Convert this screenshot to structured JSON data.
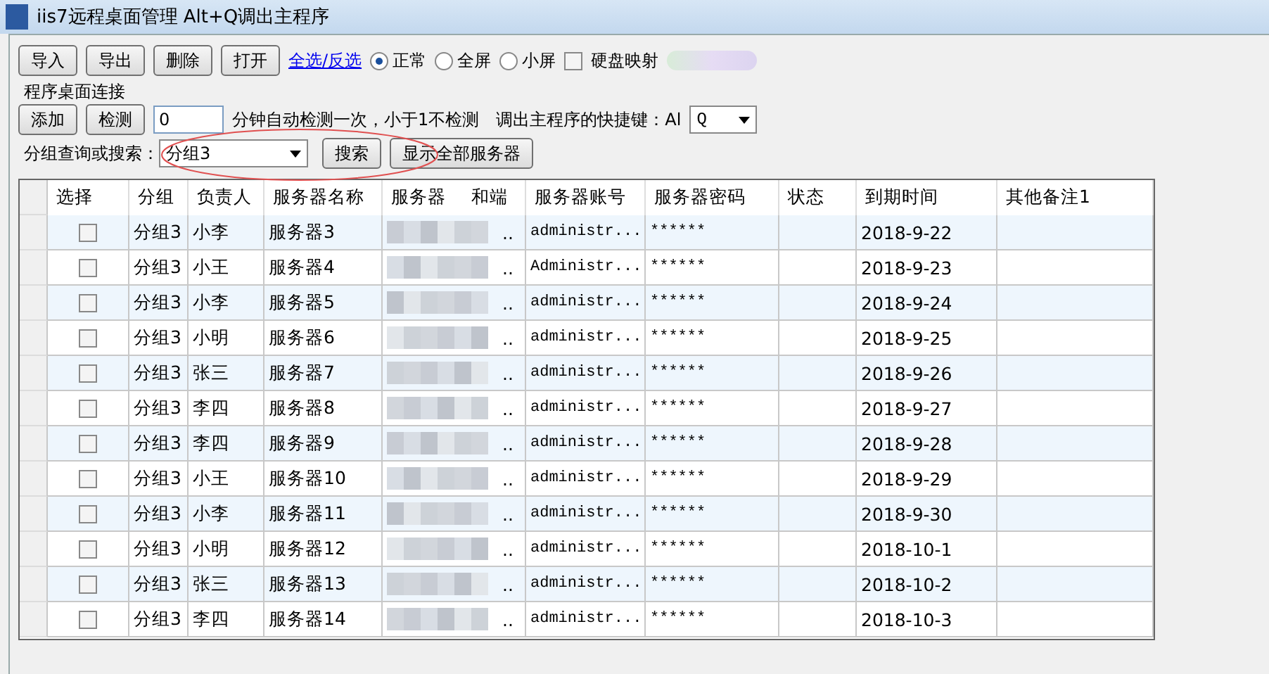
{
  "window": {
    "title": "iis7远程桌面管理 Alt+Q调出主程序"
  },
  "toolbar": {
    "buttons": [
      "导入",
      "导出",
      "删除",
      "打开"
    ],
    "link": "全选/反选",
    "view_modes": [
      {
        "label": "正常",
        "selected": true
      },
      {
        "label": "全屏",
        "selected": false
      },
      {
        "label": "小屏",
        "selected": false
      }
    ],
    "disk_mapping": {
      "label": "硬盘映射",
      "checked": false
    }
  },
  "group": {
    "title": "程序桌面连接",
    "buttons": [
      "添加",
      "检测"
    ],
    "interval": {
      "value": "0"
    },
    "interval_label": "分钟自动检测一次，小于1不检测",
    "hotkey_label": "调出主程序的快捷键：Al",
    "hotkey": {
      "value": "Q"
    },
    "search_label": "分组查询或搜索：",
    "search": {
      "value": "分组3"
    },
    "search_button": "搜索",
    "show_all_button": "显示全部服务器"
  },
  "table": {
    "columns": [
      "选择",
      "分组",
      "负责人",
      "服务器名称",
      {
        "parts": [
          "服务器",
          "和端"
        ]
      },
      "服务器账号",
      "服务器密码",
      "状态",
      "到期时间",
      "其他备注1"
    ],
    "rows": [
      {
        "checked": false,
        "group": "分组3",
        "owner": "小李",
        "name": "服务器3",
        "address": "..",
        "account": "administr...",
        "password": "******",
        "status": "",
        "expires": "2018-9-22"
      },
      {
        "checked": false,
        "group": "分组3",
        "owner": "小王",
        "name": "服务器4",
        "address": "..",
        "account": "Administr...",
        "password": "******",
        "status": "",
        "expires": "2018-9-23"
      },
      {
        "checked": false,
        "group": "分组3",
        "owner": "小李",
        "name": "服务器5",
        "address": "..",
        "account": "administr...",
        "password": "******",
        "status": "",
        "expires": "2018-9-24"
      },
      {
        "checked": false,
        "group": "分组3",
        "owner": "小明",
        "name": "服务器6",
        "address": "..",
        "account": "administr...",
        "password": "******",
        "status": "",
        "expires": "2018-9-25"
      },
      {
        "checked": false,
        "group": "分组3",
        "owner": "张三",
        "name": "服务器7",
        "address": "..",
        "account": "administr...",
        "password": "******",
        "status": "",
        "expires": "2018-9-26"
      },
      {
        "checked": false,
        "group": "分组3",
        "owner": "李四",
        "name": "服务器8",
        "address": "..",
        "account": "administr...",
        "password": "******",
        "status": "",
        "expires": "2018-9-27"
      },
      {
        "checked": false,
        "group": "分组3",
        "owner": "李四",
        "name": "服务器9",
        "address": "..",
        "account": "administr...",
        "password": "******",
        "status": "",
        "expires": "2018-9-28"
      },
      {
        "checked": false,
        "group": "分组3",
        "owner": "小王",
        "name": "服务器10",
        "address": "..",
        "account": "administr...",
        "password": "******",
        "status": "",
        "expires": "2018-9-29"
      },
      {
        "checked": false,
        "group": "分组3",
        "owner": "小李",
        "name": "服务器11",
        "address": "..",
        "account": "administr...",
        "password": "******",
        "status": "",
        "expires": "2018-9-30"
      },
      {
        "checked": false,
        "group": "分组3",
        "owner": "小明",
        "name": "服务器12",
        "address": "..",
        "account": "administr...",
        "password": "******",
        "status": "",
        "expires": "2018-10-1"
      },
      {
        "checked": false,
        "group": "分组3",
        "owner": "张三",
        "name": "服务器13",
        "address": "..",
        "account": "administr...",
        "password": "******",
        "status": "",
        "expires": "2018-10-2"
      },
      {
        "checked": false,
        "group": "分组3",
        "owner": "李四",
        "name": "服务器14",
        "address": "..",
        "account": "administr...",
        "password": "******",
        "status": "",
        "expires": "2018-10-3"
      }
    ]
  }
}
